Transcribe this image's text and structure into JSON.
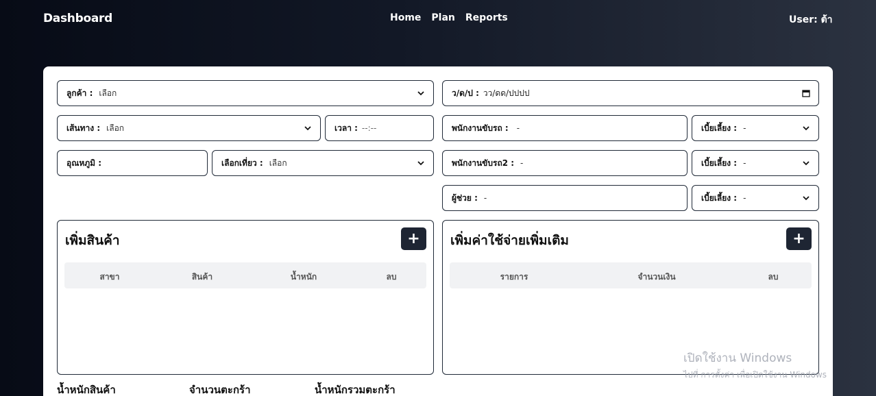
{
  "header": {
    "brand": "Dashboard",
    "nav": [
      "Home",
      "Plan",
      "Reports"
    ],
    "user": "User: ต้า"
  },
  "form": {
    "customer": {
      "label": "ลูกค้า :",
      "value": "เลือก"
    },
    "date": {
      "label": "ว/ด/ป :",
      "placeholder": "วว/ดด/ปปปป"
    },
    "route": {
      "label": "เส้นทาง :",
      "value": "เลือก"
    },
    "time": {
      "label": "เวลา :",
      "placeholder": "--:--"
    },
    "driver": {
      "label": "พนักงานขับรถ :",
      "value": "-"
    },
    "driver_allowance": {
      "label": "เบี้ยเลี้ยง :",
      "value": "-"
    },
    "temperature": {
      "label": "อุณหภูมิ :",
      "value": ""
    },
    "trip": {
      "label": "เลือกเที่ยว :",
      "value": "เลือก"
    },
    "driver2": {
      "label": "พนักงานขับรถ2 :",
      "value": "-"
    },
    "driver2_allowance": {
      "label": "เบี้ยเลี้ยง :",
      "value": "-"
    },
    "assistant": {
      "label": "ผู้ช่วย :",
      "value": "-"
    },
    "assistant_allowance": {
      "label": "เบี้ยเลี้ยง :",
      "value": "-"
    }
  },
  "products_panel": {
    "title": "เพิ่มสินค้า",
    "add_label": "+",
    "columns": [
      "สาขา",
      "สินค้า",
      "น้ำหนัก",
      "ลบ"
    ]
  },
  "expenses_panel": {
    "title": "เพิ่มค่าใช้จ่ายเพิ่มเติม",
    "add_label": "+",
    "columns": [
      "รายการ",
      "จำนวนเงิน",
      "ลบ"
    ]
  },
  "summary": {
    "product_weight": "น้ำหนักสินค้า",
    "basket_count": "จำนวนตะกร้า",
    "basket_total_weight": "น้ำหนักรวมตะกร้า"
  },
  "watermark": {
    "line1": "เปิดใช้งาน Windows",
    "line2": "ไปที่ การตั้งค่า เพื่อเปิดใช้งาน Windows"
  },
  "colors": {
    "button_dark": "#1e2533",
    "table_header_bg": "#f1f2f4",
    "border": "#1f2937"
  },
  "icons": {
    "dropdown": "chevron-down-icon",
    "calendar": "calendar-icon"
  }
}
